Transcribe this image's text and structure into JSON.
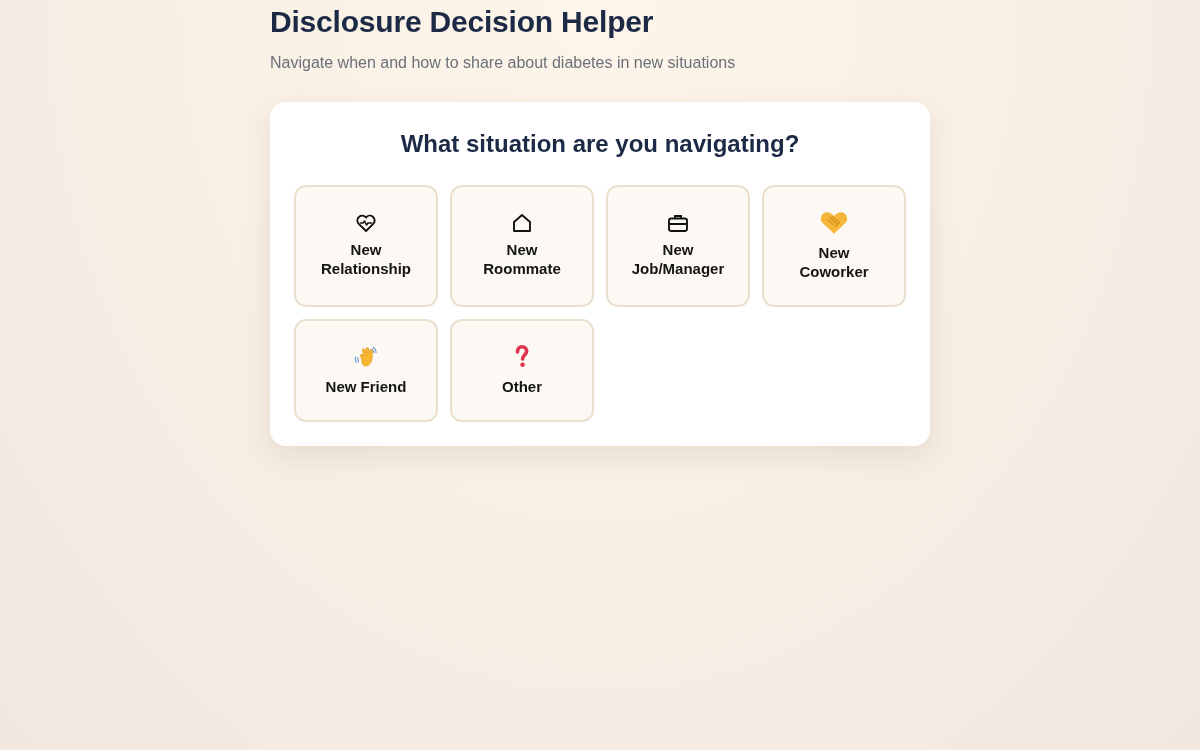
{
  "page": {
    "title": "Disclosure Decision Helper",
    "subtitle": "Navigate when and how to share about diabetes in new situations"
  },
  "card": {
    "heading": "What situation are you navigating?",
    "options": [
      {
        "label": "New Relationship",
        "selected": false
      },
      {
        "label": "New Roommate",
        "selected": false
      },
      {
        "label": "New Job/Manager",
        "selected": false
      },
      {
        "label": "New Coworker",
        "selected": false
      },
      {
        "label": "New Friend",
        "selected": false
      },
      {
        "label": "Other",
        "selected": false
      }
    ]
  }
}
